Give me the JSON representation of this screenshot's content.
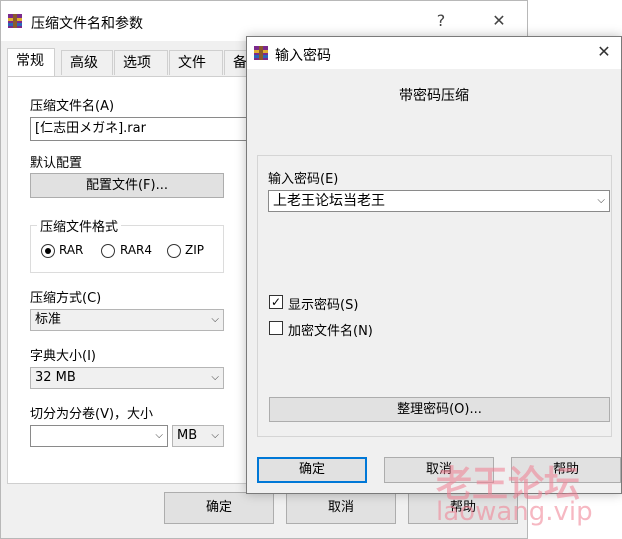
{
  "background_window": {
    "title": "压缩文件名和参数",
    "help": "?",
    "close": "✕",
    "tabs": [
      "常规",
      "高级",
      "选项",
      "文件",
      "备"
    ],
    "archive_name_label": "压缩文件名(A)",
    "archive_name_value": "[仁志田メガネ].rar",
    "default_profile_label": "默认配置",
    "profile_button": "配置文件(F)...",
    "format_group_label": "压缩文件格式",
    "formats": [
      "RAR",
      "RAR4",
      "ZIP"
    ],
    "selected_format": "RAR",
    "method_label": "压缩方式(C)",
    "method_value": "标准",
    "dict_label": "字典大小(I)",
    "dict_value": "32 MB",
    "split_label": "切分为分卷(V)，大小",
    "split_value": "",
    "split_unit": "MB",
    "ok_button": "确定",
    "cancel_button": "取消",
    "help_button": "帮助"
  },
  "dialog": {
    "title": "输入密码",
    "close": "✕",
    "heading": "带密码压缩",
    "password_label": "输入密码(E)",
    "password_value": "上老王论坛当老王",
    "show_password_label": "显示密码(S)",
    "show_password_checked": true,
    "encrypt_names_label": "加密文件名(N)",
    "encrypt_names_checked": false,
    "organize_button": "整理密码(O)...",
    "ok_button": "确定",
    "cancel_button": "取消",
    "help_button": "帮助"
  },
  "watermark": {
    "line1": "老王论坛",
    "line2": "laowang.vip"
  },
  "colors": {
    "accent": "#0078d7",
    "watermark": "#f07f92"
  }
}
